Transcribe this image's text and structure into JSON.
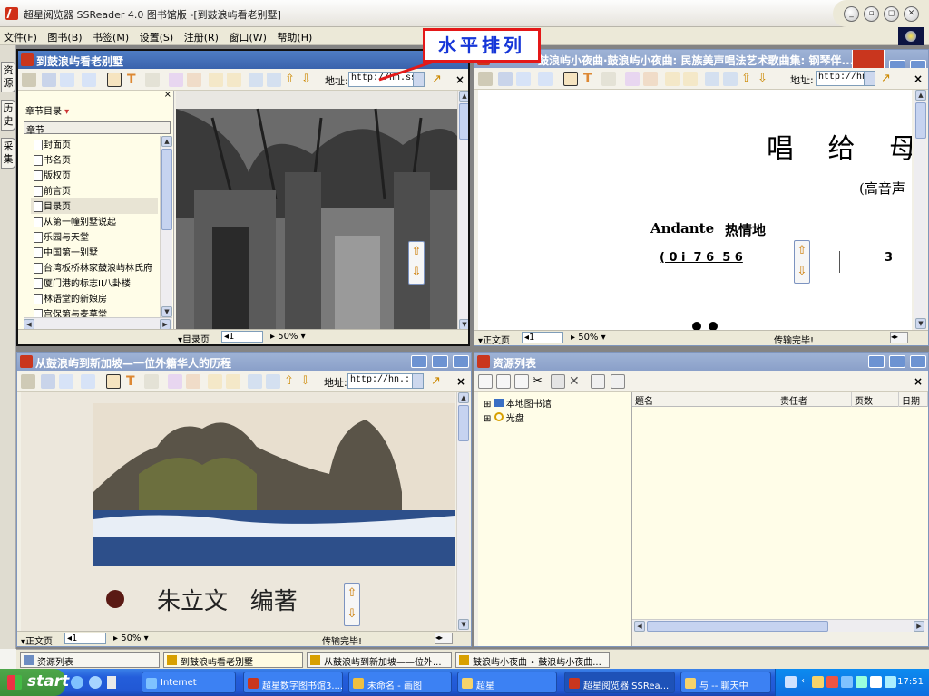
{
  "app": {
    "title": "超星阅览器 SSReader 4.0 图书馆版 -[到鼓浪屿看老别墅]",
    "window_buttons": [
      "minimize",
      "restore",
      "maximize",
      "close"
    ]
  },
  "menu": {
    "items": [
      "文件(F)",
      "图书(B)",
      "书签(M)",
      "设置(S)",
      "注册(R)",
      "窗口(W)",
      "帮助(H)"
    ]
  },
  "side_tabs": [
    "资源",
    "历史",
    "采集"
  ],
  "callout": {
    "text": "水平排列",
    "color": "#e41818"
  },
  "windows": {
    "w1": {
      "title": "到鼓浪屿看老别墅",
      "address_label": "地址:",
      "address": "http://hn.ssl",
      "toc_header": "章节目录",
      "toc_column": "章节",
      "toc_items": [
        "封面页",
        "书名页",
        "版权页",
        "前言页",
        "目录页",
        "从第一幢别墅说起",
        "乐园与天堂",
        "中国第一别墅",
        "台湾板桥林家鼓浪屿林氏府",
        "厦门港的标志II八卦楼",
        "林语堂的新娘房",
        "宫保第与麦草堂"
      ],
      "status_page_type": "目录页",
      "status_page_num": "1",
      "status_zoom": "50%"
    },
    "w2": {
      "title": "鼓浪屿小夜曲·鼓浪屿小夜曲: 民族美声唱法艺术歌曲集: 钢琴伴...",
      "address_label": "地址:",
      "address": "http://hn.",
      "song_title": "唱 给 母 亲",
      "song_voice": "(高音声",
      "tempo": "Andante",
      "tempo_cn": "热情地",
      "notation": "( 0 i  7 6  5 6",
      "notation_2": "3",
      "status_page_type": "正文页",
      "status_page_num": "1",
      "status_zoom": "50%",
      "status_msg": "传输完毕!"
    },
    "w3": {
      "title": "从鼓浪屿到新加坡—一位外籍华人的历程",
      "address_label": "地址:",
      "address": "http://hn.:",
      "author_line": "朱立文   编著",
      "status_page_type": "正文页",
      "status_page_num": "1",
      "status_zoom": "50%",
      "status_msg": "传输完毕!"
    },
    "w4": {
      "title": "资源列表",
      "tree_items": [
        "本地图书馆",
        "光盘"
      ],
      "columns": [
        "题名",
        "责任者",
        "页数",
        "日期"
      ]
    }
  },
  "task_windows": [
    {
      "label": "资源列表",
      "active": false
    },
    {
      "label": "到鼓浪屿看老别墅",
      "active": true
    },
    {
      "label": "从鼓浪屿到新加坡——位外...",
      "active": false
    },
    {
      "label": "鼓浪屿小夜曲 • 鼓浪屿小夜曲...",
      "active": false
    }
  ],
  "taskbar": {
    "start_label": "start",
    "tasks": [
      {
        "label": "Internet",
        "active": false
      },
      {
        "label": "超星数字图书馆3....",
        "active": false
      },
      {
        "label": "未命名 - 画图",
        "active": false
      },
      {
        "label": "超星",
        "active": false
      },
      {
        "label": "超星阅览器 SSRea...",
        "active": true
      },
      {
        "label": "与 -- 聊天中",
        "active": false
      }
    ],
    "clock": "17:51"
  }
}
